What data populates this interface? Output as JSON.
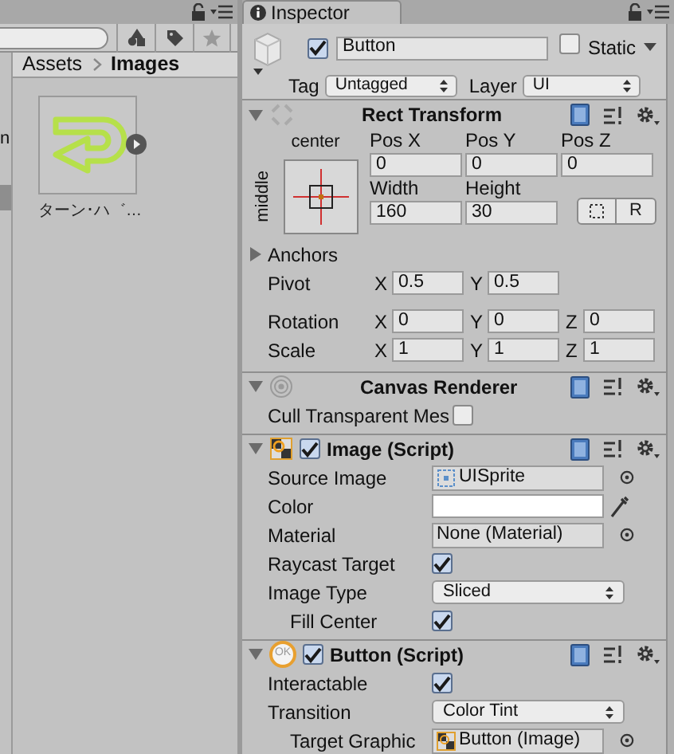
{
  "project": {
    "cut_label": "n",
    "breadcrumb": [
      {
        "label": "Assets"
      },
      {
        "label": "Images"
      }
    ],
    "assets": [
      {
        "name": "ターン･ハ゛…"
      }
    ]
  },
  "inspector": {
    "tab": "Inspector",
    "object": {
      "active": true,
      "name": "Button",
      "static": false,
      "static_label": "Static",
      "tag_label": "Tag",
      "tag": "Untagged",
      "layer_label": "Layer",
      "layer": "UI"
    },
    "components": [
      {
        "kind": "rect_transform",
        "title": "Rect Transform",
        "expanded": true,
        "anchor_h": "center",
        "anchor_v": "middle",
        "top_labels": [
          "Pos X",
          "Pos Y",
          "Pos Z"
        ],
        "top_values": [
          "0",
          "0",
          "0"
        ],
        "size_labels": [
          "Width",
          "Height"
        ],
        "size_values": [
          "160",
          "30"
        ],
        "raw_button": "R",
        "anchors": {
          "label": "Anchors",
          "expanded": false
        },
        "vectors": [
          {
            "label": "Pivot",
            "axes": [
              {
                "axis": "X",
                "value": "0.5"
              },
              {
                "axis": "Y",
                "value": "0.5"
              }
            ]
          },
          {
            "label": "Rotation",
            "axes": [
              {
                "axis": "X",
                "value": "0"
              },
              {
                "axis": "Y",
                "value": "0"
              },
              {
                "axis": "Z",
                "value": "0"
              }
            ]
          },
          {
            "label": "Scale",
            "axes": [
              {
                "axis": "X",
                "value": "1"
              },
              {
                "axis": "Y",
                "value": "1"
              },
              {
                "axis": "Z",
                "value": "1"
              }
            ]
          }
        ]
      },
      {
        "kind": "script",
        "title": "Canvas Renderer",
        "expanded": true,
        "rows": [
          {
            "kind": "checkbox",
            "label": "Cull Transparent Mes",
            "checked": false
          }
        ]
      },
      {
        "kind": "script",
        "title": "Image (Script)",
        "enabled": true,
        "expanded": true,
        "rows": [
          {
            "kind": "asset_ref",
            "label": "Source Image",
            "value": "UISprite"
          },
          {
            "kind": "color",
            "label": "Color",
            "color": "#ffffff"
          },
          {
            "kind": "object",
            "label": "Material",
            "value": "None (Material)"
          },
          {
            "kind": "checkbox",
            "label": "Raycast Target",
            "checked": true
          },
          {
            "kind": "dropdown",
            "label": "Image Type",
            "value": "Sliced",
            "children": [
              {
                "kind": "checkbox",
                "label": "Fill Center",
                "checked": true
              }
            ]
          }
        ]
      },
      {
        "kind": "script",
        "icon_text": "OK",
        "title": "Button (Script)",
        "enabled": true,
        "expanded": true,
        "rows": [
          {
            "kind": "checkbox",
            "label": "Interactable",
            "checked": true
          },
          {
            "kind": "dropdown",
            "label": "Transition",
            "value": "Color Tint",
            "children": [
              {
                "kind": "component_ref",
                "label": "Target Graphic",
                "value": "Button (Image)"
              }
            ]
          }
        ]
      }
    ]
  }
}
